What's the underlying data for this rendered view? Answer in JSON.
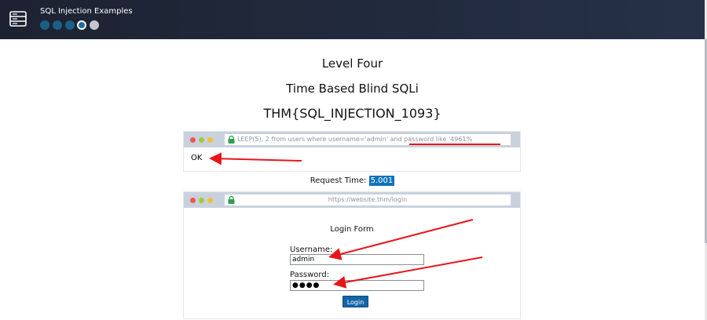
{
  "app": {
    "title": "SQL Injection Examples",
    "progress": {
      "total": 5,
      "completed": 3,
      "current": 4
    }
  },
  "level": {
    "heading": "Level Four",
    "subheading": "Time Based Blind SQLi",
    "flag": "THM{SQL_INJECTION_1093}"
  },
  "query_window": {
    "url_text": "LEEP(5), 2 from users where username='admin' and password like '4961%",
    "result": "OK"
  },
  "request_time": {
    "label": "Request Time:",
    "value": "5.001"
  },
  "login_window": {
    "url": "https://website.thm/login",
    "form_title": "Login Form",
    "username_label": "Username:",
    "username_value": "admin",
    "password_label": "Password:",
    "password_masked": "●●●●",
    "login_button": "Login"
  },
  "colors": {
    "topbar": "#1c2231",
    "accent": "#1273b8",
    "annotation": "#e8161b"
  }
}
